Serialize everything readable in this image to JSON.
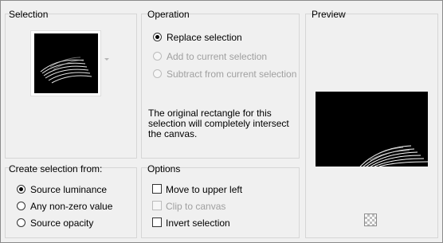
{
  "selection": {
    "title": "Selection"
  },
  "operation": {
    "title": "Operation",
    "options": [
      {
        "label": "Replace selection",
        "selected": true,
        "enabled": true
      },
      {
        "label": "Add to current selection",
        "selected": false,
        "enabled": false
      },
      {
        "label": "Subtract from current selection",
        "selected": false,
        "enabled": false
      }
    ],
    "note": "The original rectangle for this selection will completely intersect the canvas."
  },
  "preview": {
    "title": "Preview"
  },
  "create_from": {
    "title": "Create selection from:",
    "options": [
      {
        "label": "Source luminance",
        "selected": true
      },
      {
        "label": "Any non-zero value",
        "selected": false
      },
      {
        "label": "Source opacity",
        "selected": false
      }
    ]
  },
  "options": {
    "title": "Options",
    "items": [
      {
        "label": "Move to upper left",
        "checked": false,
        "enabled": true
      },
      {
        "label": "Clip to canvas",
        "checked": false,
        "enabled": false
      },
      {
        "label": "Invert selection",
        "checked": false,
        "enabled": true
      }
    ]
  },
  "icons": {
    "dropdown": "chevron-down-icon",
    "preview_background": "checkerboard-icon"
  }
}
